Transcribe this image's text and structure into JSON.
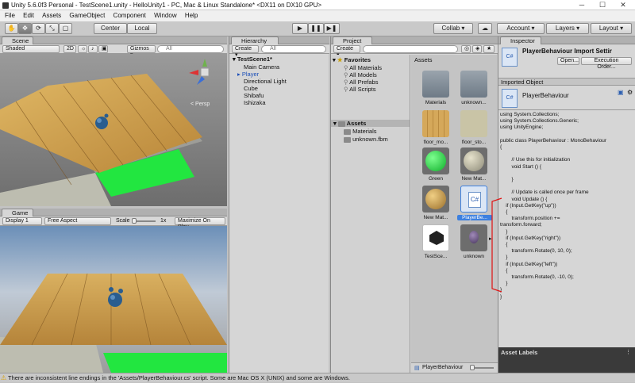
{
  "window": {
    "title": "Unity 5.6.0f3 Personal - TestScene1.unity - HelloUnity1 - PC, Mac & Linux Standalone* <DX11 on DX10 GPU>",
    "minimize": "─",
    "maximize": "☐",
    "close": "✕"
  },
  "menu": [
    "File",
    "Edit",
    "Assets",
    "GameObject",
    "Component",
    "Window",
    "Help"
  ],
  "toolbar": {
    "center": "Center",
    "local": "Local",
    "collab": "Collab ▾",
    "account": "Account ▾",
    "layers": "Layers ▾",
    "layout": "Layout ▾"
  },
  "scene": {
    "tab": "Scene",
    "shading": "Shaded",
    "mode2d": "2D",
    "gizmos": "Gizmos ▾",
    "search": "All",
    "persp": "< Persp"
  },
  "game": {
    "tab": "Game",
    "display": "Display 1",
    "aspect": "Free Aspect",
    "scale_label": "Scale",
    "scale_value": "1x",
    "maximize": "Maximize On Play"
  },
  "hierarchy": {
    "tab": "Hierarchy",
    "create": "Create ▾",
    "search": "All",
    "scene": "TestScene1*",
    "items": [
      "Main Camera",
      "Player",
      "Directional Light",
      "Cube",
      "Shibafu",
      "Ishizaka"
    ]
  },
  "project": {
    "tab": "Project",
    "create": "Create ▾",
    "favorites": "Favorites",
    "fav_items": [
      "All Materials",
      "All Models",
      "All Prefabs",
      "All Scripts"
    ],
    "assets_root": "Assets",
    "asset_folders": [
      "Materials",
      "unknown.fbm"
    ],
    "breadcrumb": "Assets",
    "selected_path": "PlayerBehaviour",
    "items": [
      "Materials",
      "unknown...",
      "floor_mo...",
      "floor_sto...",
      "Green",
      "New Mat...",
      "New Mat...",
      "PlayerBe...",
      "TestSce...",
      "unknown"
    ]
  },
  "inspector": {
    "tab": "Inspector",
    "title": "PlayerBehaviour Import Settir",
    "open": "Open...",
    "exec": "Execution Order...",
    "imported": "Imported Object",
    "object_name": "PlayerBehaviour",
    "asset_labels": "Asset Labels"
  },
  "code": "using System.Collections;\nusing System.Collections.Generic;\nusing UnityEngine;\n\npublic class PlayerBehaviour : MonoBehaviour\n{\n\n        // Use this for initialization\n        void Start () {\n\n        }\n\n        // Update is called once per frame\n        void Update () {\n    if (Input.GetKey(\"up\"))\n    {\n        transform.position +=\ntransform.forward;\n    }\n    if (Input.GetKey(\"right\"))\n    {\n        transform.Rotate(0, 10, 0);\n    }\n    if (Input.GetKey(\"left\"))\n    {\n        transform.Rotate(0, -10, 0);\n    }\n}\n}",
  "status": "There are inconsistent line endings in the 'Assets/PlayerBehaviour.cs' script. Some are Mac OS X (UNIX) and some are Windows.",
  "colors": {
    "selection": "#3d80df",
    "green_floor": "#22e640",
    "wood": "#c89a4a",
    "annotation": "#e01010"
  }
}
